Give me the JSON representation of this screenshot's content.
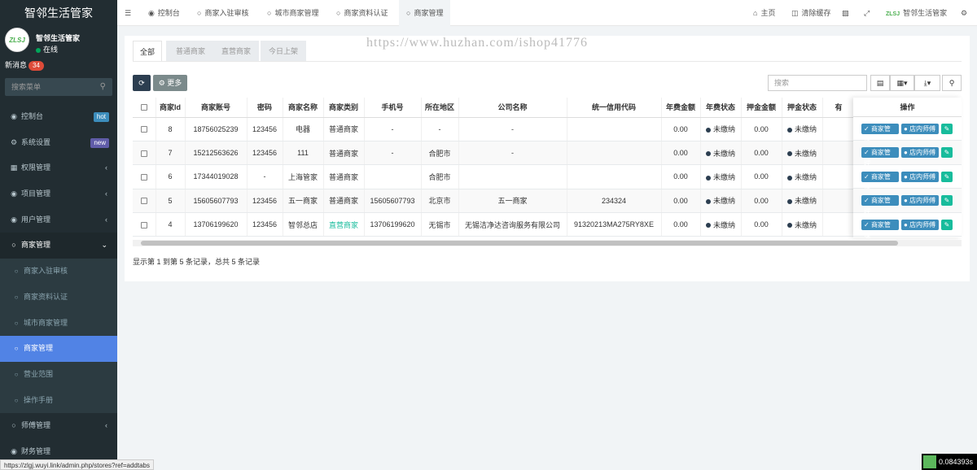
{
  "brand": "智邻生活管家",
  "user": {
    "avatar_text": "ZLSJ",
    "name": "智邻生活管家",
    "status": "在线"
  },
  "messages": {
    "label": "新消息",
    "count": "34"
  },
  "sidebar_search": {
    "placeholder": "搜索菜单"
  },
  "menu": [
    {
      "label": "控制台",
      "tag": "hot"
    },
    {
      "label": "系统设置",
      "tag": "new"
    },
    {
      "label": "权限管理"
    },
    {
      "label": "项目管理"
    },
    {
      "label": "用户管理"
    },
    {
      "label": "商家管理"
    },
    {
      "label": "商家入驻审核"
    },
    {
      "label": "商家资料认证"
    },
    {
      "label": "城市商家管理"
    },
    {
      "label": "商家管理"
    },
    {
      "label": "营业范围"
    },
    {
      "label": "操作手册"
    },
    {
      "label": "师傅管理"
    },
    {
      "label": "财务管理"
    }
  ],
  "topnav": {
    "tabs": [
      "控制台",
      "商家入驻审核",
      "城市商家管理",
      "商家资料认证",
      "商家管理"
    ],
    "home": "主页",
    "clear_cache": "清除缓存",
    "account": "智邻生活管家"
  },
  "watermark": "https://www.huzhan.com/ishop41776",
  "filter_tabs": [
    "全部",
    "普通商家",
    "直营商家",
    "今日上架"
  ],
  "toolbar": {
    "more": "更多",
    "search_placeholder": "搜索"
  },
  "table": {
    "headers": [
      "商家Id",
      "商家账号",
      "密码",
      "商家名称",
      "商家类别",
      "手机号",
      "所在地区",
      "公司名称",
      "统一信用代码",
      "年费金额",
      "年费状态",
      "押金金额",
      "押金状态",
      "有"
    ],
    "rows": [
      [
        "8",
        "18756025239",
        "123456",
        "电器",
        "普通商家",
        "-",
        "-",
        "-",
        "",
        "0.00",
        "未缴纳",
        "0.00",
        "未缴纳"
      ],
      [
        "7",
        "15212563626",
        "123456",
        "111",
        "普通商家",
        "-",
        "合肥市",
        "-",
        "",
        "0.00",
        "未缴纳",
        "0.00",
        "未缴纳"
      ],
      [
        "6",
        "17344019028",
        "-",
        "上海管家",
        "普通商家",
        "",
        "合肥市",
        "",
        "",
        "0.00",
        "未缴纳",
        "0.00",
        "未缴纳"
      ],
      [
        "5",
        "15605607793",
        "123456",
        "五一商家",
        "普通商家",
        "15605607793",
        "北京市",
        "五一商家",
        "234324",
        "0.00",
        "未缴纳",
        "0.00",
        "未缴纳"
      ],
      [
        "4",
        "13706199620",
        "123456",
        "智邻总店",
        "直营商家",
        "13706199620",
        "无锡市",
        "无锡洁净达咨询服务有限公司",
        "91320213MA275RY8XE",
        "0.00",
        "未缴纳",
        "0.00",
        "未缴纳"
      ]
    ],
    "action_header": "操作",
    "action_manage": "商家管理",
    "action_staff": "店内师傅"
  },
  "pagination_text": "显示第 1 到第 5 条记录，总共 5 条记录",
  "statusbar_url": "https://zlgj.wuyi.link/admin.php/stores?ref=addtabs",
  "timer": "0.084393s",
  "colors": {
    "sidebar": "#222d32",
    "active": "#5183e5",
    "primary": "#3c8dbc",
    "success": "#18bc9c"
  }
}
